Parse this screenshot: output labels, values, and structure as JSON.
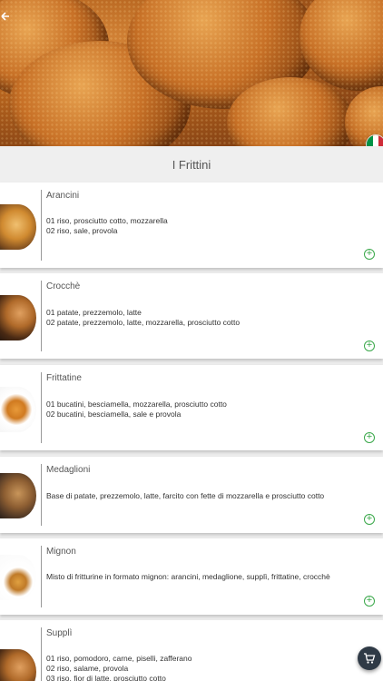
{
  "header": {
    "back_icon": "arrow-left-icon",
    "language_flag": "italy-flag-icon",
    "flag_colors": [
      "#009246",
      "#ffffff",
      "#ce2b37"
    ]
  },
  "section": {
    "title": "I Frittini"
  },
  "items": [
    {
      "name": "Arancini",
      "lines": [
        "01 riso, prosciutto cotto, mozzarella",
        "02 riso, sale, provola"
      ]
    },
    {
      "name": "Crocchè",
      "lines": [
        "01 patate, prezzemolo, latte",
        "02 patate, prezzemolo, latte, mozzarella, prosciutto cotto"
      ]
    },
    {
      "name": "Frittatine",
      "lines": [
        "01 bucatini, besciamella, mozzarella, prosciutto cotto",
        "02 bucatini, besciamella, sale e provola"
      ]
    },
    {
      "name": "Medaglioni",
      "lines": [
        "Base di patate, prezzemolo, latte, farcito con fette di mozzarella e prosciutto cotto"
      ]
    },
    {
      "name": "Mignon",
      "lines": [
        "Misto di fritturine in formato mignon: arancini, medaglione, supplì, frittatine, crocchè"
      ]
    },
    {
      "name": "Supplì",
      "lines": [
        "01 riso, pomodoro, carne, piselli, zafferano",
        "02 riso, salame, provola",
        "03 riso, fior di latte, prosciutto cotto"
      ]
    }
  ],
  "actions": {
    "add_icon": "plus-circle-icon",
    "cart_icon": "shopping-cart-icon"
  },
  "colors": {
    "accent_green": "#3aa84a",
    "cart_bg": "#2f3a46"
  }
}
